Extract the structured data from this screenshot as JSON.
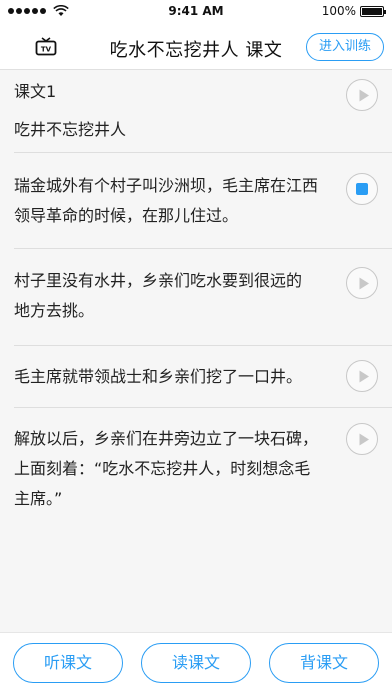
{
  "status_bar": {
    "time": "9:41 AM",
    "battery": "100%"
  },
  "header": {
    "title": "吃水不忘挖井人 课文",
    "train_button": "进入训练",
    "left_icon": "tv-icon"
  },
  "lesson": {
    "label": "课文1",
    "name": "吃井不忘挖井人"
  },
  "sentences": [
    {
      "line1": "瑞金城外有个村子叫沙洲坝，毛主席在江西",
      "line2": "领导革命的时候，在那儿住过。",
      "state": "playing"
    },
    {
      "line1": "村子里没有水井，乡亲们吃水要到很远的",
      "line2": "地方去挑。",
      "state": "idle"
    },
    {
      "line1": "毛主席就带领战士和乡亲们挖了一口井。",
      "state": "idle"
    },
    {
      "line1": "解放以后，乡亲们在井旁边立了一块石碑，",
      "line2": "上面刻着：“吃水不忘挖井人，时刻想念毛",
      "line3": "主席。”",
      "state": "idle"
    }
  ],
  "bottom": {
    "listen": "听课文",
    "read": "读课文",
    "recite": "背课文"
  },
  "colors": {
    "accent": "#2a9df4"
  }
}
